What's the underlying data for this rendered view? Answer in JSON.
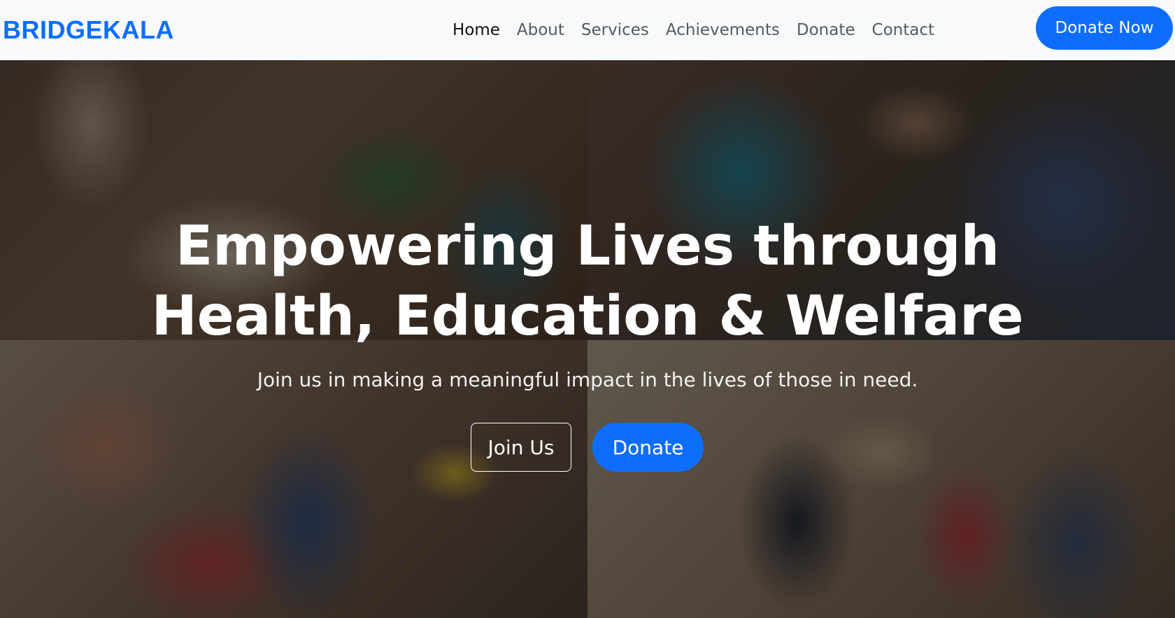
{
  "brand": {
    "name": "BRIDGEKALA",
    "color": "#0d6efd"
  },
  "nav": {
    "items": [
      {
        "label": "Home",
        "active": true
      },
      {
        "label": "About",
        "active": false
      },
      {
        "label": "Services",
        "active": false
      },
      {
        "label": "Achievements",
        "active": false
      },
      {
        "label": "Donate",
        "active": false
      },
      {
        "label": "Contact",
        "active": false
      }
    ],
    "cta_label": "Donate Now"
  },
  "hero": {
    "title_line1": "Empowering Lives through",
    "title_line2": "Health, Education & Welfare",
    "subtitle": "Join us in making a meaningful impact in the lives of those in need.",
    "join_label": "Join Us",
    "donate_label": "Donate",
    "accent_color": "#0d6efd"
  }
}
